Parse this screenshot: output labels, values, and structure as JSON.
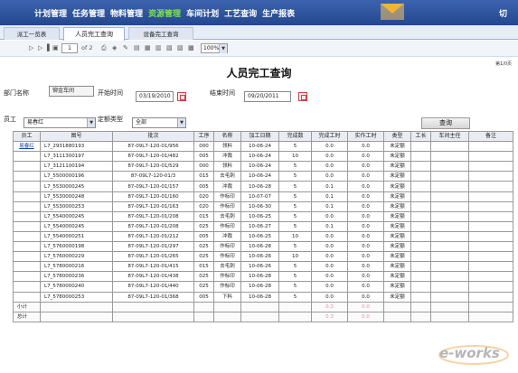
{
  "nav": {
    "items": [
      "计划管理",
      "任务管理",
      "物料管理",
      "资源管理",
      "车间计划",
      "工艺查询",
      "生产报表"
    ],
    "active_index": 3,
    "right_text": "切"
  },
  "tabs": [
    "派工一览表",
    "人员完工查询",
    "设备完工查询"
  ],
  "active_tab": 1,
  "toolbar": {
    "page_number": "1",
    "page_of": "of 2",
    "zoom": "100%",
    "page_count_right": "第1/0页"
  },
  "report": {
    "title": "人员完工查询"
  },
  "filters": {
    "dept_label": "部门名称",
    "dept_value": "铆金车间",
    "start_label": "开始时间",
    "start_value": "03/19/2010",
    "end_label": "结束时间",
    "end_value": "09/20/2011",
    "employee_label": "员工",
    "employee_value": "易春红",
    "quota_label": "定额类型",
    "quota_value": "全部",
    "query_button": "查询"
  },
  "table": {
    "headers": [
      "员工",
      "图号",
      "批次",
      "工序",
      "名称",
      "加工日期",
      "完成数",
      "完成工时",
      "实作工时",
      "类型",
      "工长",
      "车间主任",
      "备注"
    ],
    "rows": [
      [
        "易春红",
        "L7_2931880193",
        "87-09L7-120-01/956",
        "000",
        "领料",
        "10-06-24",
        "5",
        "0.0",
        "0.0",
        "未定额",
        "",
        "",
        ""
      ],
      [
        "",
        "L7_3111300197",
        "87-09L7-120-01/482",
        "005",
        "冲裁",
        "10-06-24",
        "10",
        "0.0",
        "0.0",
        "未定额",
        "",
        "",
        ""
      ],
      [
        "",
        "L7_3121100194",
        "87-09L7-120-01/529",
        "000",
        "领料",
        "10-06-24",
        "5",
        "0.0",
        "0.0",
        "未定额",
        "",
        "",
        ""
      ],
      [
        "",
        "L7_5500000196",
        "87-09L7-120-01/3",
        "015",
        "去毛刺",
        "10-06-24",
        "5",
        "0.0",
        "0.0",
        "未定额",
        "",
        "",
        ""
      ],
      [
        "",
        "L7_5530000245",
        "87-09L7-120-01/157",
        "005",
        "冲裁",
        "10-06-28",
        "5",
        "0.1",
        "0.0",
        "未定额",
        "",
        "",
        ""
      ],
      [
        "",
        "L7_5530000248",
        "87-09L7-120-01/160",
        "020",
        "作标印",
        "10-07-07",
        "5",
        "0.1",
        "0.0",
        "未定额",
        "",
        "",
        ""
      ],
      [
        "",
        "L7_5530000253",
        "87-09L7-120-01/163",
        "020",
        "作标印",
        "10-06-30",
        "5",
        "0.1",
        "0.0",
        "未定额",
        "",
        "",
        ""
      ],
      [
        "",
        "L7_5540000245",
        "87-09L7-120-01/208",
        "015",
        "去毛刺",
        "10-06-25",
        "5",
        "0.0",
        "0.0",
        "未定额",
        "",
        "",
        ""
      ],
      [
        "",
        "L7_5540000245",
        "87-09L7-120-01/208",
        "025",
        "作标印",
        "10-06-27",
        "5",
        "0.1",
        "0.0",
        "未定额",
        "",
        "",
        ""
      ],
      [
        "",
        "L7_5540000251",
        "87-09L7-120-01/212",
        "005",
        "冲裁",
        "10-06-25",
        "10",
        "0.0",
        "0.0",
        "未定额",
        "",
        "",
        ""
      ],
      [
        "",
        "L7_5760000198",
        "87-09L7-120-01/297",
        "025",
        "作标印",
        "10-06-28",
        "5",
        "0.0",
        "0.0",
        "未定额",
        "",
        "",
        ""
      ],
      [
        "",
        "L7_5760000229",
        "87-09L7-120-01/265",
        "025",
        "作标印",
        "10-06-26",
        "10",
        "0.0",
        "0.0",
        "未定额",
        "",
        "",
        ""
      ],
      [
        "",
        "L7_5780000216",
        "87-09L7-120-01/415",
        "015",
        "去毛刺",
        "10-06-26",
        "5",
        "0.0",
        "0.0",
        "未定额",
        "",
        "",
        ""
      ],
      [
        "",
        "L7_5780000236",
        "87-09L7-120-01/438",
        "025",
        "作标印",
        "10-06-28",
        "5",
        "0.0",
        "0.0",
        "未定额",
        "",
        "",
        ""
      ],
      [
        "",
        "L7_5780000240",
        "87-09L7-120-01/440",
        "025",
        "作标印",
        "10-06-28",
        "5",
        "0.0",
        "0.0",
        "未定额",
        "",
        "",
        ""
      ],
      [
        "",
        "L7_5780000253",
        "87-09L7-120-01/368",
        "005",
        "下料",
        "10-06-28",
        "5",
        "0.0",
        "0.0",
        "未定额",
        "",
        "",
        ""
      ]
    ],
    "subtotal": {
      "label": "小计",
      "done_hours": "0.3",
      "actual_hours": "0.0"
    },
    "total": {
      "label": "总计",
      "done_hours": "0.3",
      "actual_hours": "0.0"
    }
  },
  "watermark": "e-works"
}
